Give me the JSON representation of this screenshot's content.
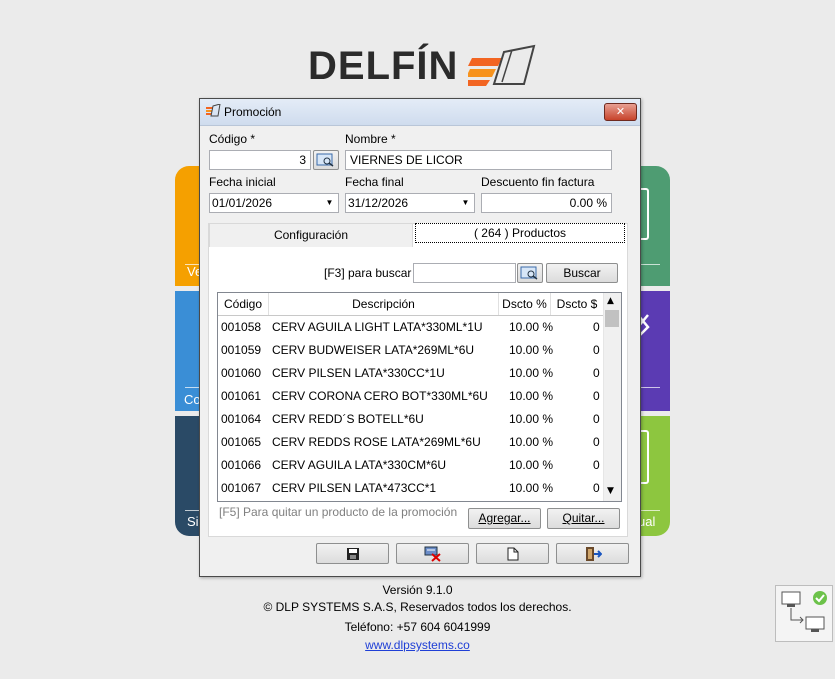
{
  "logo": {
    "text": "DELFÍN"
  },
  "tiles": [
    {
      "label": "Ve",
      "color": "#f5a000"
    },
    {
      "label": "Co",
      "color": "#3a8ed6"
    },
    {
      "label": "Si",
      "color": "#2a4a66"
    }
  ],
  "tiles_right": [
    {
      "label": "",
      "color": "#4e9c72"
    },
    {
      "label": "",
      "color": "#5b3bb3"
    },
    {
      "label": "ual",
      "color": "#8dc63f"
    }
  ],
  "dialog": {
    "title": "Promoción",
    "close_icon": "close-icon",
    "codigo_label": "Código *",
    "codigo_value": "3",
    "nombre_label": "Nombre *",
    "nombre_value": "VIERNES DE LICOR",
    "fecha_inicial_label": "Fecha inicial",
    "fecha_inicial_value": "01/01/2026",
    "fecha_final_label": "Fecha final",
    "fecha_final_value": "31/12/2026",
    "descuento_label": "Descuento fin factura",
    "descuento_value": "0.00 %",
    "tabs": [
      {
        "label": "Configuración"
      },
      {
        "label": "( 264 ) Productos"
      }
    ],
    "search_label": "[F3] para buscar",
    "search_value": "",
    "buscar_button": "Buscar",
    "columns": [
      "Código",
      "Descripción",
      "Dscto %",
      "Dscto $"
    ],
    "rows": [
      {
        "codigo": "001058",
        "descripcion": "CERV AGUILA LIGHT LATA*330ML*1U",
        "pct": "10.00 %",
        "val": "0"
      },
      {
        "codigo": "001059",
        "descripcion": "CERV BUDWEISER LATA*269ML*6U",
        "pct": "10.00 %",
        "val": "0"
      },
      {
        "codigo": "001060",
        "descripcion": "CERV PILSEN LATA*330CC*1U",
        "pct": "10.00 %",
        "val": "0"
      },
      {
        "codigo": "001061",
        "descripcion": "CERV CORONA CERO BOT*330ML*6U",
        "pct": "10.00 %",
        "val": "0"
      },
      {
        "codigo": "001064",
        "descripcion": "CERV REDD´S BOTELL*6U",
        "pct": "10.00 %",
        "val": "0"
      },
      {
        "codigo": "001065",
        "descripcion": "CERV REDDS ROSE LATA*269ML*6U",
        "pct": "10.00 %",
        "val": "0"
      },
      {
        "codigo": "001066",
        "descripcion": "CERV AGUILA LATA*330CM*6U",
        "pct": "10.00 %",
        "val": "0"
      },
      {
        "codigo": "001067",
        "descripcion": "CERV PILSEN LATA*473CC*1",
        "pct": "10.00 %",
        "val": "0"
      }
    ],
    "hint": "[F5] Para quitar un producto de la promoción",
    "agregar_button": "Agregar...",
    "quitar_button": "Quitar...",
    "toolbar_icons": [
      "save-icon",
      "delete-icon",
      "new-document-icon",
      "exit-icon"
    ]
  },
  "footer": {
    "version": "Versión 9.1.0",
    "copyright": "© DLP SYSTEMS S.A.S, Reservados todos los derechos.",
    "phone": "Teléfono: +57 604 6041999",
    "website": "www.dlpsystems.co"
  }
}
